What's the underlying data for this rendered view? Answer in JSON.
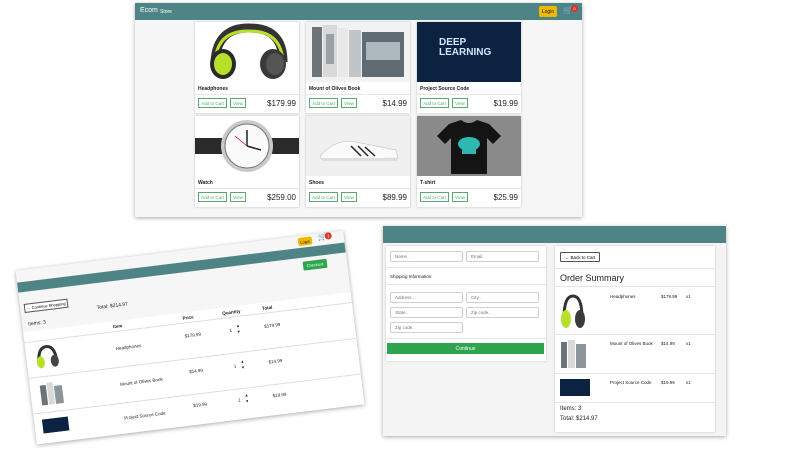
{
  "store": {
    "brand": "Ecom",
    "nav_store": "Store",
    "login": "Login",
    "cart_count": "0",
    "products": [
      {
        "name": "Headphones",
        "price": "$179.99"
      },
      {
        "name": "Mount of Olives Book",
        "price": "$14.99"
      },
      {
        "name": "Project Source Code",
        "price": "$19.99"
      },
      {
        "name": "Watch",
        "price": "$259.00"
      },
      {
        "name": "Shoes",
        "price": "$89.99"
      },
      {
        "name": "T-shirt",
        "price": "$25.99"
      }
    ],
    "add_to_cart_label": "Add to Cart",
    "view_label": "View",
    "deep_learning_line1": "DEEP",
    "deep_learning_line2": "LEARNING"
  },
  "cart": {
    "login": "Login",
    "cart_count": "3",
    "continue_shopping": "← Continue Shopping",
    "checkout": "Checkout",
    "items_label": "Items: 3",
    "total_label": "Total: $214.97",
    "columns": {
      "item": "Item",
      "price": "Price",
      "quantity": "Quantity",
      "total": "Total"
    },
    "rows": [
      {
        "name": "Headphones",
        "price": "$179.99",
        "qty": "1",
        "total": "$179.99"
      },
      {
        "name": "Mount of Olives Book",
        "price": "$14.99",
        "qty": "1",
        "total": "$14.99"
      },
      {
        "name": "Project Source Code",
        "price": "$19.99",
        "qty": "1",
        "total": "$19.99"
      }
    ]
  },
  "checkout": {
    "name_placeholder": "Name..",
    "email_placeholder": "Email..",
    "shipping_label": "Shipping Information:",
    "address_placeholder": "Address..",
    "city_placeholder": "City..",
    "state_placeholder": "State..",
    "zip_placeholder": "Zip code..",
    "continue": "Continue",
    "back_to_cart": "← Back to Cart",
    "summary_title": "Order Summary",
    "items": [
      {
        "name": "Headphones",
        "price": "$179.99",
        "qty": "x1"
      },
      {
        "name": "Mount of Olives Book",
        "price": "$14.99",
        "qty": "x1"
      },
      {
        "name": "Project Source Code",
        "price": "$19.99",
        "qty": "x1"
      }
    ],
    "items_label": "Items: 3",
    "total_label": "Total: $214.97"
  },
  "colors": {
    "navbar": "#4f8486",
    "login": "#f0b800",
    "success": "#2ea44f",
    "badge": "#d9342b"
  },
  "icons": [
    "cart-icon",
    "caret-up-icon",
    "caret-down-icon"
  ]
}
